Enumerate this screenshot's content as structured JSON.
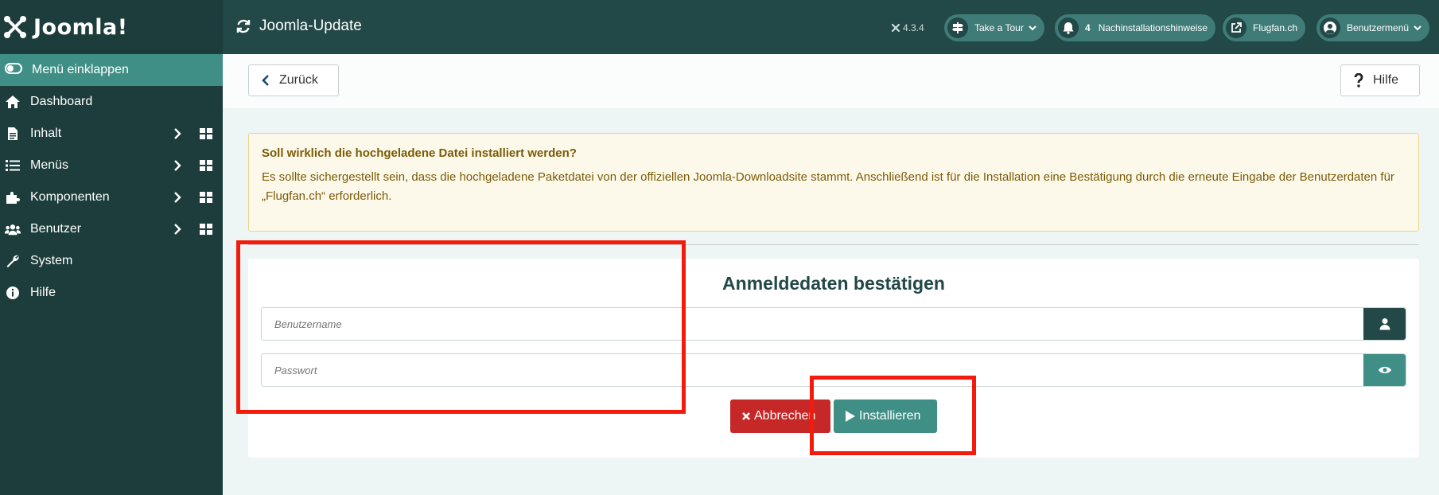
{
  "sidebar": {
    "logo": "Joomla!",
    "collapse_label": "Menü einklappen",
    "items": [
      {
        "label": "Dashboard",
        "icon": "home-icon"
      },
      {
        "label": "Inhalt",
        "icon": "file-icon"
      },
      {
        "label": "Menüs",
        "icon": "list-icon"
      },
      {
        "label": "Komponenten",
        "icon": "puzzle-icon"
      },
      {
        "label": "Benutzer",
        "icon": "users-icon"
      },
      {
        "label": "System",
        "icon": "wrench-icon"
      },
      {
        "label": "Hilfe",
        "icon": "info-icon"
      }
    ]
  },
  "header": {
    "title": "Joomla-Update",
    "version": "4.3.4",
    "tour_label": "Take a Tour",
    "notifications_count": "4",
    "notifications_label": "Nachinstallationshinweise",
    "site_label": "Flugfan.ch",
    "user_menu_label": "Benutzermenü"
  },
  "toolbar": {
    "back_label": "Zurück",
    "help_label": "Hilfe"
  },
  "alert": {
    "title": "Soll wirklich die hochgeladene Datei installiert werden?",
    "body": "Es sollte sichergestellt sein, dass die hochgeladene Paketdatei von der offiziellen Joomla-Downloadsite stammt. Anschließend ist für die Installation eine Bestätigung durch die erneute Eingabe der Benutzerdaten für „Flugfan.ch“ erforderlich."
  },
  "form": {
    "title": "Anmeldedaten bestätigen",
    "username_placeholder": "Benutzername",
    "password_placeholder": "Passwort",
    "cancel_label": "Abbrechen",
    "install_label": "Installieren"
  },
  "colors": {
    "sidebar": "#1c3d3c",
    "header": "#224847",
    "accent": "#3f8f86",
    "danger": "#c52827",
    "annotation": "#f21b0c"
  }
}
